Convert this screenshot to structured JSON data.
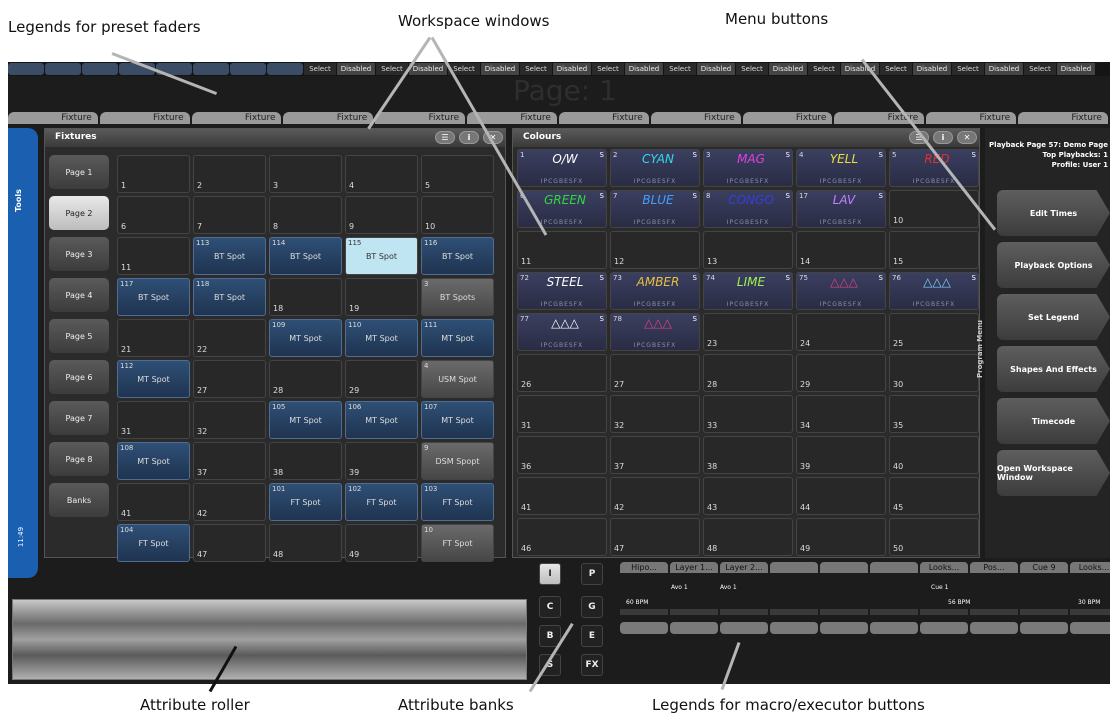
{
  "annotations": {
    "preset_faders": "Legends for preset faders",
    "workspace_windows": "Workspace windows",
    "menu_buttons": "Menu buttons",
    "attribute_roller": "Attribute roller",
    "attribute_banks": "Attribute banks",
    "macro_executor": "Legends for macro/executor buttons"
  },
  "top_strip": [
    "Select",
    "Disabled",
    "Select",
    "Disabled",
    "Select",
    "Disabled",
    "Select",
    "Disabled",
    "Select",
    "Disabled",
    "Select",
    "Disabled",
    "Select",
    "Disabled",
    "Select",
    "Disabled",
    "Select",
    "Disabled",
    "Select",
    "Disabled",
    "Select",
    "Disabled"
  ],
  "page_label": "Page: 1",
  "fixture_legends": [
    "Fixture",
    "Fixture",
    "Fixture",
    "Fixture",
    "Fixture",
    "Fixture",
    "Fixture",
    "Fixture",
    "Fixture",
    "Fixture",
    "Fixture",
    "Fixture"
  ],
  "tools_tab": {
    "label": "Tools",
    "clock": "11:49"
  },
  "fixtures_window": {
    "title": "Fixtures",
    "pages": [
      "Page 1",
      "Page 2",
      "Page 3",
      "Page 4",
      "Page 5",
      "Page 6",
      "Page 7",
      "Page 8",
      "Banks"
    ],
    "active_page": 1,
    "cells": [
      {
        "n": "1"
      },
      {
        "n": "2"
      },
      {
        "n": "3"
      },
      {
        "n": "4"
      },
      {
        "n": "5"
      },
      {
        "n": "6"
      },
      {
        "n": "7"
      },
      {
        "n": "8"
      },
      {
        "n": "9"
      },
      {
        "n": "10"
      },
      {
        "n": "11"
      },
      {
        "t": "113",
        "l": "BT Spot",
        "s": "blue"
      },
      {
        "t": "114",
        "l": "BT Spot",
        "s": "blue"
      },
      {
        "t": "115",
        "l": "BT Spot",
        "s": "sel"
      },
      {
        "t": "116",
        "l": "BT Spot",
        "s": "blue"
      },
      {
        "t": "117",
        "l": "BT Spot",
        "s": "blue"
      },
      {
        "t": "118",
        "l": "BT Spot",
        "s": "blue"
      },
      {
        "n": "18"
      },
      {
        "n": "19"
      },
      {
        "t": "3",
        "l": "BT Spots",
        "s": "grey"
      },
      {
        "n": "21"
      },
      {
        "n": "22"
      },
      {
        "t": "109",
        "l": "MT Spot",
        "s": "blue"
      },
      {
        "t": "110",
        "l": "MT Spot",
        "s": "blue"
      },
      {
        "t": "111",
        "l": "MT Spot",
        "s": "blue"
      },
      {
        "t": "112",
        "l": "MT Spot",
        "s": "blue"
      },
      {
        "n": "27"
      },
      {
        "n": "28"
      },
      {
        "n": "29"
      },
      {
        "t": "4",
        "l": "USM Spot",
        "s": "grey"
      },
      {
        "n": "31"
      },
      {
        "n": "32"
      },
      {
        "t": "105",
        "l": "MT Spot",
        "s": "blue"
      },
      {
        "t": "106",
        "l": "MT Spot",
        "s": "blue"
      },
      {
        "t": "107",
        "l": "MT Spot",
        "s": "blue"
      },
      {
        "t": "108",
        "l": "MT Spot",
        "s": "blue"
      },
      {
        "n": "37"
      },
      {
        "n": "38"
      },
      {
        "n": "39"
      },
      {
        "t": "9",
        "l": "DSM Spopt",
        "s": "grey"
      },
      {
        "n": "41"
      },
      {
        "n": "42"
      },
      {
        "t": "101",
        "l": "FT Spot",
        "s": "blue"
      },
      {
        "t": "102",
        "l": "FT Spot",
        "s": "blue"
      },
      {
        "t": "103",
        "l": "FT Spot",
        "s": "blue"
      },
      {
        "t": "104",
        "l": "FT Spot",
        "s": "blue"
      },
      {
        "n": "47"
      },
      {
        "n": "48"
      },
      {
        "n": "49"
      },
      {
        "t": "10",
        "l": "FT Spot",
        "s": "grey"
      }
    ]
  },
  "colours_window": {
    "title": "Colours",
    "ipc": "IPCGBESFX",
    "cells": [
      {
        "t": "1",
        "w": "O/W",
        "c": "#ffffff"
      },
      {
        "t": "2",
        "w": "CYAN",
        "c": "#2fd8e8"
      },
      {
        "t": "3",
        "w": "MAG",
        "c": "#e040e0"
      },
      {
        "t": "4",
        "w": "YELL",
        "c": "#e8e040"
      },
      {
        "t": "5",
        "w": "RED",
        "c": "#e03030"
      },
      {
        "t": "6",
        "w": "GREEN",
        "c": "#30d840"
      },
      {
        "t": "7",
        "w": "BLUE",
        "c": "#40a0ff"
      },
      {
        "t": "8",
        "w": "CONGO",
        "c": "#3040e0"
      },
      {
        "t": "17",
        "w": "LAV",
        "c": "#c080ff"
      },
      {
        "n": "10"
      },
      {
        "n": "11"
      },
      {
        "n": "12"
      },
      {
        "n": "13"
      },
      {
        "n": "14"
      },
      {
        "n": "15"
      },
      {
        "t": "72",
        "w": "STEEL",
        "c": "#ffffff"
      },
      {
        "t": "73",
        "w": "AMBER",
        "c": "#e8c040"
      },
      {
        "t": "74",
        "w": "LIME",
        "c": "#a0f050"
      },
      {
        "t": "75",
        "w": "△△△",
        "c": "#e04080"
      },
      {
        "t": "76",
        "w": "△△△",
        "c": "#80d0ff"
      },
      {
        "t": "77",
        "w": "△△△",
        "c": "#ffffff"
      },
      {
        "t": "78",
        "w": "△△△",
        "c": "#e04080"
      },
      {
        "n": "23"
      },
      {
        "n": "24"
      },
      {
        "n": "25"
      },
      {
        "n": "26"
      },
      {
        "n": "27"
      },
      {
        "n": "28"
      },
      {
        "n": "29"
      },
      {
        "n": "30"
      },
      {
        "n": "31"
      },
      {
        "n": "32"
      },
      {
        "n": "33"
      },
      {
        "n": "34"
      },
      {
        "n": "35"
      },
      {
        "n": "36"
      },
      {
        "n": "37"
      },
      {
        "n": "38"
      },
      {
        "n": "39"
      },
      {
        "n": "40"
      },
      {
        "n": "41"
      },
      {
        "n": "42"
      },
      {
        "n": "43"
      },
      {
        "n": "44"
      },
      {
        "n": "45"
      },
      {
        "n": "46"
      },
      {
        "n": "47"
      },
      {
        "n": "48"
      },
      {
        "n": "49"
      },
      {
        "n": "50"
      }
    ]
  },
  "playback_info": {
    "line1": "Playback Page 57: Demo Page",
    "line2": "Top Playbacks: 1",
    "line3": "Profile: User 1"
  },
  "program_menu_label": "Program Menu",
  "menu_buttons": [
    "Edit Times",
    "Playback Options",
    "Set Legend",
    "Shapes And Effects",
    "Timecode",
    "Open Workspace Window"
  ],
  "attribute_banks": [
    "I",
    "P",
    "C",
    "G",
    "B",
    "E",
    "S",
    "FX"
  ],
  "macro_legends": [
    "Hipo...",
    "Layer 1...",
    "Layer 2...",
    "",
    "",
    "",
    "Looks...",
    "Pos...",
    "Cue 9",
    "Looks..."
  ],
  "executor_info": {
    "avo1": "Avo 1",
    "avo2": "Avo 1",
    "cue": "Cue  1",
    "bpm1": "60 BPM",
    "bpm2": "56 BPM",
    "bpm3": "30 BPM"
  }
}
